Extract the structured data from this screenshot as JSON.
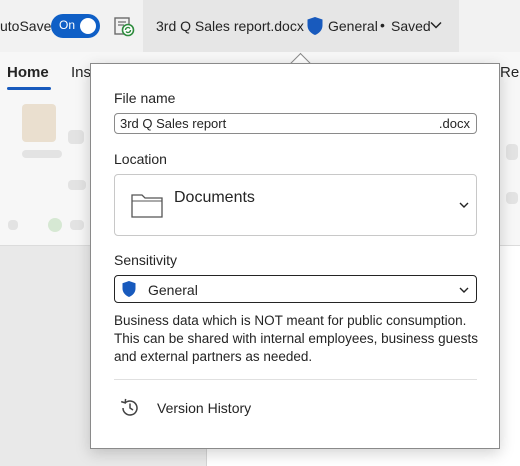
{
  "titlebar": {
    "autosave_label": "utoSave",
    "autosave_toggle_text": "On",
    "document_title": "3rd Q Sales report.docx",
    "sensitivity": "General",
    "separator": "•",
    "status": "Saved"
  },
  "ribbon": {
    "tabs": [
      {
        "label": "Home",
        "active": true
      },
      {
        "label": "Ins"
      },
      {
        "label": "Re"
      }
    ]
  },
  "popup": {
    "file_name_label": "File name",
    "file_name_value": "3rd Q Sales report",
    "file_extension": ".docx",
    "location_label": "Location",
    "location_value": "Documents",
    "sensitivity_label": "Sensitivity",
    "sensitivity_value": "General",
    "sensitivity_description": "Business data which is NOT meant for public consumption. This can be shared with internal employees, business guests and external partners as needed.",
    "version_history_label": "Version History"
  },
  "icons": {
    "sync": "sync-icon",
    "shield": "shield-icon",
    "folder": "folder-icon",
    "chevron": "chevron-down-icon",
    "history": "history-icon"
  },
  "colors": {
    "accent": "#0f5fc6",
    "shield": "#185abd",
    "sync_green": "#2e8b3d"
  }
}
